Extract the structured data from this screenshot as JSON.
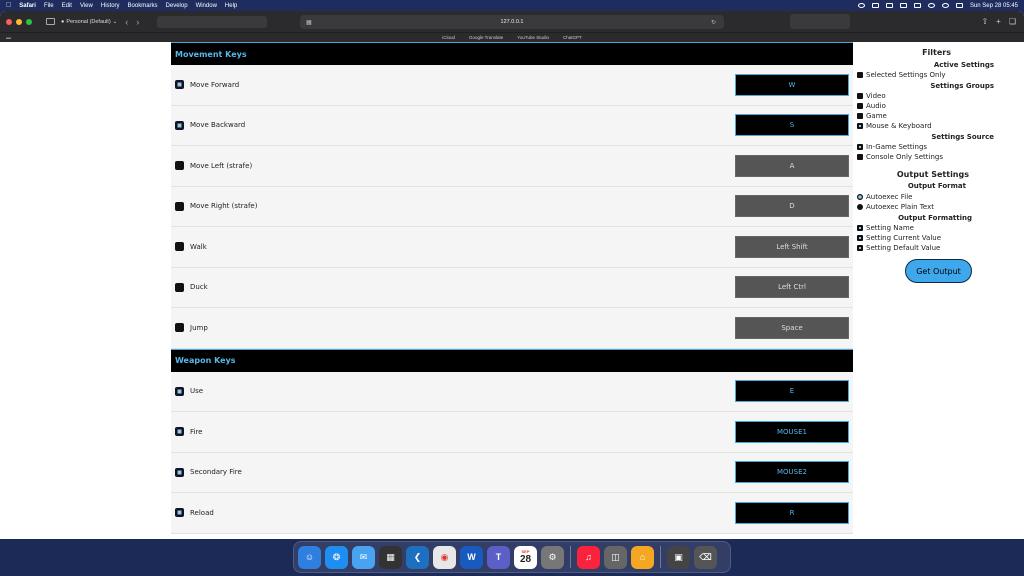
{
  "menubar": {
    "app": "Safari",
    "items": [
      "File",
      "Edit",
      "View",
      "History",
      "Bookmarks",
      "Develop",
      "Window",
      "Help"
    ],
    "clock": "Sun Sep 28  05:45"
  },
  "browser": {
    "profile": "Personal (Default)",
    "url": "127.0.0.1",
    "favorites": [
      "iCloud",
      "Google Translate",
      "YouTube Studio",
      "ChatGPT"
    ]
  },
  "sections": [
    {
      "title": "Movement Keys",
      "rows": [
        {
          "label": "Move Forward",
          "key": "W",
          "checked": true,
          "active": true
        },
        {
          "label": "Move Backward",
          "key": "S",
          "checked": true,
          "active": true
        },
        {
          "label": "Move Left (strafe)",
          "key": "A",
          "checked": false,
          "active": false
        },
        {
          "label": "Move Right (strafe)",
          "key": "D",
          "checked": false,
          "active": false
        },
        {
          "label": "Walk",
          "key": "Left Shift",
          "checked": false,
          "active": false
        },
        {
          "label": "Duck",
          "key": "Left Ctrl",
          "checked": false,
          "active": false
        },
        {
          "label": "Jump",
          "key": "Space",
          "checked": false,
          "active": false
        }
      ]
    },
    {
      "title": "Weapon Keys",
      "rows": [
        {
          "label": "Use",
          "key": "E",
          "checked": true,
          "active": true
        },
        {
          "label": "Fire",
          "key": "MOUSE1",
          "checked": true,
          "active": true
        },
        {
          "label": "Secondary Fire",
          "key": "MOUSE2",
          "checked": true,
          "active": true
        },
        {
          "label": "Reload",
          "key": "R",
          "checked": true,
          "active": true
        }
      ]
    }
  ],
  "filters": {
    "title": "Filters",
    "active_settings": {
      "heading": "Active Settings",
      "selected_only": "Selected Settings Only"
    },
    "settings_groups": {
      "heading": "Settings Groups",
      "video": "Video",
      "audio": "Audio",
      "game": "Game",
      "mouse_keyboard": "Mouse & Keyboard"
    },
    "settings_source": {
      "heading": "Settings Source",
      "in_game": "In-Game Settings",
      "console_only": "Console Only Settings"
    },
    "output_settings": {
      "title": "Output Settings"
    },
    "output_format": {
      "heading": "Output Format",
      "autoexec_file": "Autoexec File",
      "autoexec_plain": "Autoexec Plain Text"
    },
    "output_formatting": {
      "heading": "Output Formatting",
      "setting_name": "Setting Name",
      "current_value": "Setting Current Value",
      "default_value": "Setting Default Value"
    },
    "get_output": "Get Output"
  },
  "dock": {
    "calendar_day": "28",
    "calendar_month": "SEP"
  }
}
